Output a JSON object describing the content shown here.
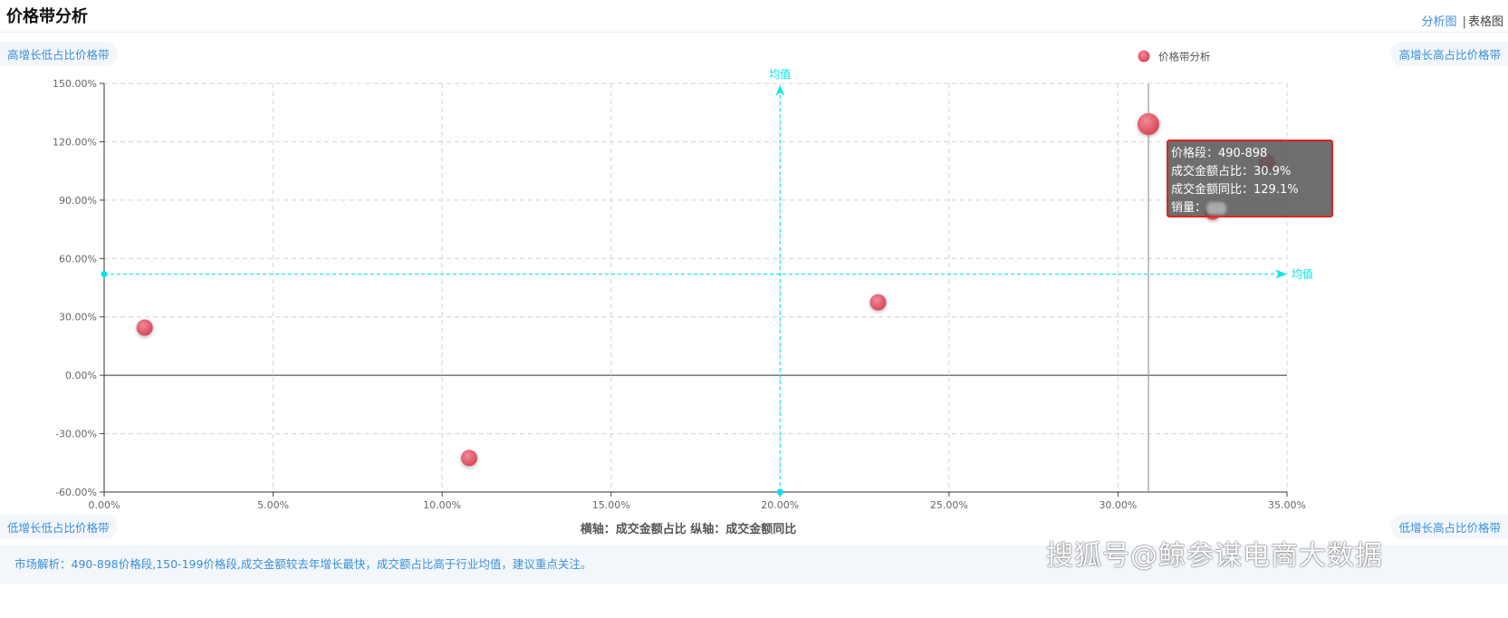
{
  "page": {
    "title": "价格带分析",
    "view_switch": {
      "analysis_label": "分析图",
      "separator": "|",
      "table_label": "表格图"
    },
    "quadrants": {
      "top_left": "高增长低占比价格带",
      "top_right": "高增长高占比价格带",
      "bottom_left": "低增长低占比价格带",
      "bottom_right": "低增长高占比价格带"
    },
    "footer_text": "市场解析：490-898价格段,150-199价格段,成交金额较去年增长最快，成交额占比高于行业均值，建议重点关注。",
    "watermark": "搜狐号@鲸参谋电商大数据"
  },
  "chart_data": {
    "type": "scatter",
    "xlabel": "横轴：成交金额占比  纵轴：成交金额同比",
    "legend": {
      "label": "价格带分析",
      "position": "top-right"
    },
    "xlim": [
      0,
      35
    ],
    "ylim": [
      -60,
      150
    ],
    "xticks": [
      "0.00%",
      "5.00%",
      "10.00%",
      "15.00%",
      "20.00%",
      "25.00%",
      "30.00%",
      "35.00%"
    ],
    "yticks": [
      "150.00%",
      "120.00%",
      "90.00%",
      "60.00%",
      "30.00%",
      "0.00%",
      "-30.00%",
      "-60.00%"
    ],
    "grid": true,
    "mean_x": 20,
    "mean_y": 52,
    "mean_label": "均值",
    "colors": {
      "point": "#e05a6a",
      "mean_line": "#00e5ee",
      "highlight": "#e05a6a"
    },
    "series": [
      {
        "points": [
          {
            "x": 1.2,
            "y": 24.5
          },
          {
            "x": 10.8,
            "y": -42.5
          },
          {
            "x": 22.9,
            "y": 37.5
          },
          {
            "x": 30.9,
            "y": 129.1,
            "highlight": true
          },
          {
            "x": 34.4,
            "y": 109.5
          },
          {
            "x": 32.8,
            "y": 84
          }
        ]
      }
    ],
    "hover_x": 30.9,
    "tooltip": {
      "line1": "价格段：490-898",
      "line2": "成交金额占比：30.9%",
      "line3": "成交金额同比：129.1%",
      "line4": "销量："
    }
  }
}
